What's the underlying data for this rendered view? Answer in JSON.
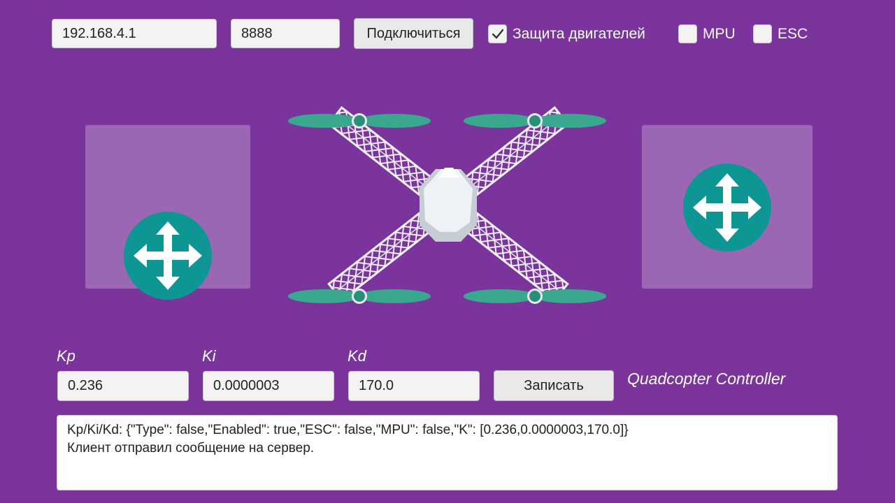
{
  "connection": {
    "ip_value": "192.168.4.1",
    "port_value": "8888",
    "connect_label": "Подключиться"
  },
  "options": [
    {
      "label": "Защита двигателей",
      "checked": true
    },
    {
      "label": "MPU",
      "checked": false
    },
    {
      "label": "ESC",
      "checked": false
    }
  ],
  "icons": {
    "left_joystick": "move-arrows-icon",
    "right_joystick": "move-arrows-icon",
    "center": "quadcopter-icon",
    "checkmark": "checkmark-icon"
  },
  "colors": {
    "background": "#7a349c",
    "joystick_knob": "#0d9693",
    "propeller": "#3aa88f"
  },
  "pid": {
    "kp_label": "Kp",
    "ki_label": "Ki",
    "kd_label": "Kd",
    "kp_value": "0.236",
    "ki_value": "0.0000003",
    "kd_value": "170.0",
    "write_label": "Записать"
  },
  "app_title": "Quadcopter Controller",
  "log": {
    "lines": [
      "Kp/Ki/Kd:  {\"Type\": false,\"Enabled\": true,\"ESC\": false,\"MPU\": false,\"K\": [0.236,0.0000003,170.0]}",
      "Клиент отправил сообщение на сервер."
    ]
  }
}
